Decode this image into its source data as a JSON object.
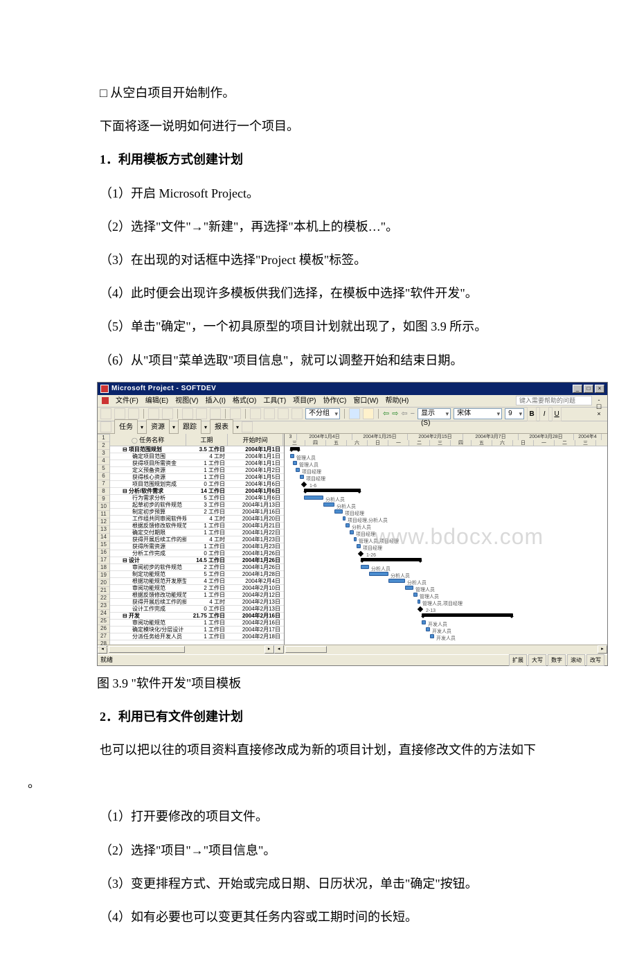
{
  "body": {
    "p1": "□ 从空白项目开始制作。",
    "p2": "下面将逐一说明如何进行一个项目。",
    "h1": "1．利用模板方式创建计划",
    "s1_1": "（1）开启 Microsoft Project。",
    "s1_2": "（2）选择\"文件\"→\"新建\"，再选择\"本机上的模板…\"。",
    "s1_3": "（3）在出现的对话框中选择\"Project 模板\"标签。",
    "s1_4": "（4）此时便会出现许多模板供我们选择，在模板中选择\"软件开发\"。",
    "s1_5": "（5）单击\"确定\"，一个初具原型的项目计划就出现了，如图 3.9 所示。",
    "s1_6": "（6）从\"项目\"菜单选取\"项目信息\"，就可以调整开始和结束日期。",
    "fig_caption": "图 3.9 \"软件开发\"项目模板",
    "h2": "2．利用已有文件创建计划",
    "p3": "也可以把以往的项目资料直接修改成为新的项目计划，直接修改文件的方法如下",
    "p3_tail": "。",
    "s2_1": "（1）打开要修改的项目文件。",
    "s2_2": "（2）选择\"项目\"→\"项目信息\"。",
    "s2_3": "（3）变更排程方式、开始或完成日期、日历状况，单击\"确定\"按钮。",
    "s2_4": "（4）如有必要也可以变更其任务内容或工期时间的长短。"
  },
  "app": {
    "title": "Microsoft Project - SOFTDEV",
    "help_placeholder": "键入需要帮助的问题",
    "menus": [
      "文件(F)",
      "编辑(E)",
      "视图(V)",
      "插入(I)",
      "格式(O)",
      "工具(T)",
      "项目(P)",
      "协作(C)",
      "窗口(W)",
      "帮助(H)"
    ],
    "group_mode": "不分组",
    "show_label": "显示(S)",
    "font_name": "宋体",
    "font_size": "9",
    "bold": "B",
    "italic": "I",
    "underline": "U",
    "tb2": [
      "任务",
      "资源",
      "跟踪",
      "报表"
    ],
    "cols": {
      "name": "任务名称",
      "dur": "工期",
      "start": "开始时间"
    },
    "timescale_top": [
      "3",
      "2004年1月4日",
      "2004年1月25日",
      "2004年2月15日",
      "2004年3月7日",
      "2004年3月28日",
      "2004年4"
    ],
    "timescale_bot": [
      "三",
      "四",
      "五",
      "六",
      "日",
      "一",
      "二",
      "三",
      "四",
      "五",
      "六",
      "日",
      "一",
      "二",
      "三"
    ],
    "status": "就绪",
    "status_cells": [
      "扩展",
      "大写",
      "数字",
      "滚动",
      "改写"
    ]
  },
  "tasks": [
    {
      "id": 1,
      "name": "项目范围规划",
      "dur": "3.5 工作日",
      "start": "2004年1月1日",
      "lvl": 0,
      "sum": true,
      "bar": [
        8,
        22
      ],
      "label": ""
    },
    {
      "id": 2,
      "name": "确定项目范围",
      "dur": "4 工时",
      "start": "2004年1月1日",
      "lvl": 1,
      "bar": [
        8,
        14
      ],
      "label": "管理人员"
    },
    {
      "id": 3,
      "name": "获得项目所需资金",
      "dur": "1 工作日",
      "start": "2004年1月1日",
      "lvl": 1,
      "bar": [
        12,
        18
      ],
      "label": "管理人员"
    },
    {
      "id": 4,
      "name": "定义预备资源",
      "dur": "1 工作日",
      "start": "2004年1月2日",
      "lvl": 1,
      "bar": [
        16,
        22
      ],
      "label": "项目经理"
    },
    {
      "id": 5,
      "name": "获得核心资源",
      "dur": "1 工作日",
      "start": "2004年1月5日",
      "lvl": 1,
      "bar": [
        22,
        28
      ],
      "label": "项目经理"
    },
    {
      "id": 6,
      "name": "项目范围规划完成",
      "dur": "0 工作日",
      "start": "2004年1月6日",
      "lvl": 1,
      "mile": 28,
      "label": "1-6"
    },
    {
      "id": 7,
      "name": "分析/软件需求",
      "dur": "14 工作日",
      "start": "2004年1月6日",
      "lvl": 0,
      "sum": true,
      "bar": [
        28,
        110
      ],
      "label": ""
    },
    {
      "id": 8,
      "name": "行为需求分析",
      "dur": "5 工作日",
      "start": "2004年1月6日",
      "lvl": 1,
      "bar": [
        28,
        56
      ],
      "label": "分析人员"
    },
    {
      "id": 9,
      "name": "起草初步的软件规范",
      "dur": "3 工作日",
      "start": "2004年1月13日",
      "lvl": 1,
      "bar": [
        56,
        72
      ],
      "label": "分析人员"
    },
    {
      "id": 10,
      "name": "制定初步预算",
      "dur": "2 工作日",
      "start": "2004年1月16日",
      "lvl": 1,
      "bar": [
        72,
        84
      ],
      "label": "项目经理"
    },
    {
      "id": 11,
      "name": "工作组共同审阅软件规",
      "dur": "4 工时",
      "start": "2004年1月20日",
      "lvl": 1,
      "bar": [
        84,
        88
      ],
      "label": "项目经理,分析人员"
    },
    {
      "id": 12,
      "name": "根据反馈修改软件规范",
      "dur": "1 工作日",
      "start": "2004年1月21日",
      "lvl": 1,
      "bar": [
        88,
        94
      ],
      "label": "分析人员"
    },
    {
      "id": 13,
      "name": "确定交付期限",
      "dur": "1 工作日",
      "start": "2004年1月22日",
      "lvl": 1,
      "bar": [
        94,
        100
      ],
      "label": "项目经理"
    },
    {
      "id": 14,
      "name": "获得开展后续工作的批",
      "dur": "4 工时",
      "start": "2004年1月23日",
      "lvl": 1,
      "bar": [
        100,
        104
      ],
      "label": "管理人员,项目经理"
    },
    {
      "id": 15,
      "name": "获得所需资源",
      "dur": "1 工作日",
      "start": "2004年1月23日",
      "lvl": 1,
      "bar": [
        104,
        110
      ],
      "label": "项目经理"
    },
    {
      "id": 16,
      "name": "分析工作完成",
      "dur": "0 工作日",
      "start": "2004年1月26日",
      "lvl": 1,
      "mile": 110,
      "label": "1-26"
    },
    {
      "id": 17,
      "name": "设计",
      "dur": "14.5 工作日",
      "start": "2004年1月26日",
      "lvl": 0,
      "sum": true,
      "bar": [
        110,
        198
      ],
      "label": ""
    },
    {
      "id": 18,
      "name": "审阅初步的软件规范",
      "dur": "2 工作日",
      "start": "2004年1月26日",
      "lvl": 1,
      "bar": [
        110,
        122
      ],
      "label": "分析人员"
    },
    {
      "id": 19,
      "name": "制定功能规范",
      "dur": "5 工作日",
      "start": "2004年1月28日",
      "lvl": 1,
      "bar": [
        122,
        150
      ],
      "label": "分析人员"
    },
    {
      "id": 20,
      "name": "根据功能规范开发原型",
      "dur": "4 工作日",
      "start": "2004年2月4日",
      "lvl": 1,
      "bar": [
        150,
        174
      ],
      "label": "分析人员"
    },
    {
      "id": 21,
      "name": "审阅功能规范",
      "dur": "2 工作日",
      "start": "2004年2月10日",
      "lvl": 1,
      "bar": [
        174,
        186
      ],
      "label": "管理人员"
    },
    {
      "id": 22,
      "name": "根据反馈修改功能规范",
      "dur": "1 工作日",
      "start": "2004年2月12日",
      "lvl": 1,
      "bar": [
        186,
        192
      ],
      "label": "管理人员"
    },
    {
      "id": 23,
      "name": "获得开展后续工作的批",
      "dur": "4 工时",
      "start": "2004年2月13日",
      "lvl": 1,
      "bar": [
        192,
        196
      ],
      "label": "管理人员,项目经理"
    },
    {
      "id": 24,
      "name": "设计工作完成",
      "dur": "0 工作日",
      "start": "2004年2月13日",
      "lvl": 1,
      "mile": 196,
      "label": "2-13"
    },
    {
      "id": 25,
      "name": "开发",
      "dur": "21.75 工作日",
      "start": "2004年2月16日",
      "lvl": 0,
      "sum": true,
      "bar": [
        198,
        330
      ],
      "label": ""
    },
    {
      "id": 26,
      "name": "审阅功能规范",
      "dur": "1 工作日",
      "start": "2004年2月16日",
      "lvl": 1,
      "bar": [
        198,
        204
      ],
      "label": "开发人员"
    },
    {
      "id": 27,
      "name": "确定模块化/分层设计",
      "dur": "1 工作日",
      "start": "2004年2月17日",
      "lvl": 1,
      "bar": [
        204,
        210
      ],
      "label": "开发人员"
    },
    {
      "id": 28,
      "name": "分派任务给开发人员",
      "dur": "1 工作日",
      "start": "2004年2月18日",
      "lvl": 1,
      "bar": [
        210,
        216
      ],
      "label": "开发人员"
    }
  ],
  "watermark": "www.bdocx.com"
}
